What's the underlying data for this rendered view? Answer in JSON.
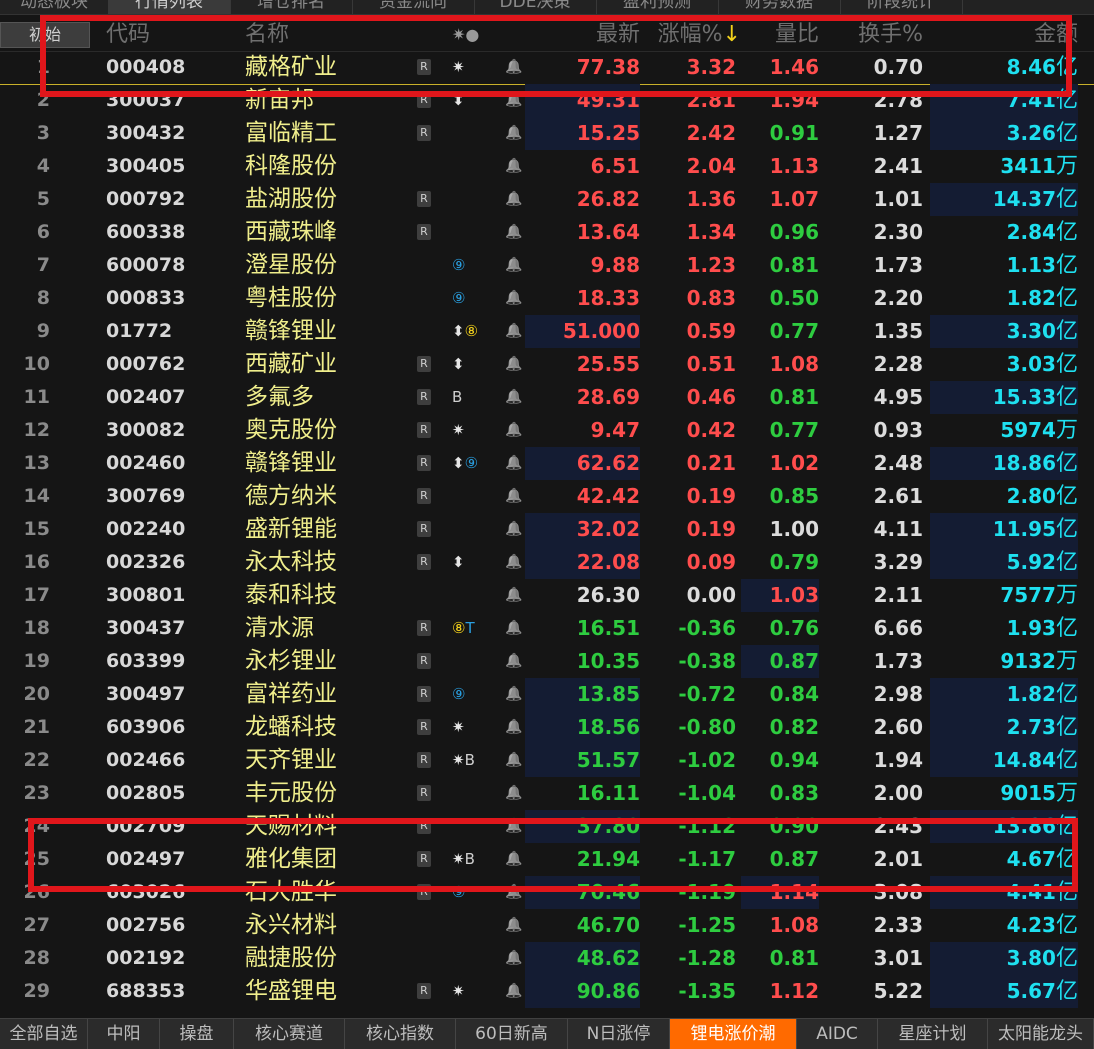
{
  "top_tabs": [
    "动态板块",
    "行情列表",
    "增仓排名",
    "资金流向",
    "DDE决策",
    "盈利预测",
    "财务数据",
    "阶段统计"
  ],
  "top_tab_active": 1,
  "header": {
    "corner_button": "初始",
    "code": "代码",
    "name": "名称",
    "flags": "✷●",
    "price": "最新",
    "change": "涨幅%",
    "sort_arrow": "↓",
    "vol_ratio": "量比",
    "turnover": "换手%",
    "amount": "金额"
  },
  "colors": {
    "up": "#ff4d4d",
    "down": "#2ecc40",
    "flat": "#dcdcdc",
    "amount": "#1fe0f0",
    "name": "#f0ee8c",
    "highlight_box": "#e0161b",
    "active_tab": "#ff6a00"
  },
  "rows": [
    {
      "idx": "1",
      "code": "000408",
      "name": "藏格矿业",
      "r": true,
      "flags": [
        {
          "t": "✷",
          "c": "w"
        }
      ],
      "price": "77.38",
      "change": "3.32",
      "vr": "1.46",
      "turnover": "0.70",
      "amt": "8.46",
      "unit": "亿",
      "pd": "up",
      "cd": "up",
      "vd": "up",
      "price_hl": false,
      "vr_hl": false,
      "amt_hl": false
    },
    {
      "idx": "2",
      "code": "300037",
      "name": "新宙邦",
      "r": true,
      "flags": [
        {
          "t": "⬍",
          "c": "w"
        }
      ],
      "price": "49.31",
      "change": "2.81",
      "vr": "1.94",
      "turnover": "2.78",
      "amt": "7.41",
      "unit": "亿",
      "pd": "up",
      "cd": "up",
      "vd": "up",
      "price_hl": true,
      "vr_hl": false,
      "amt_hl": true
    },
    {
      "idx": "3",
      "code": "300432",
      "name": "富临精工",
      "r": true,
      "flags": [],
      "price": "15.25",
      "change": "2.42",
      "vr": "0.91",
      "turnover": "1.27",
      "amt": "3.26",
      "unit": "亿",
      "pd": "up",
      "cd": "up",
      "vd": "dn",
      "price_hl": true,
      "vr_hl": false,
      "amt_hl": true
    },
    {
      "idx": "4",
      "code": "300405",
      "name": "科隆股份",
      "r": false,
      "flags": [],
      "price": "6.51",
      "change": "2.04",
      "vr": "1.13",
      "turnover": "2.41",
      "amt": "3411",
      "unit": "万",
      "pd": "up",
      "cd": "up",
      "vd": "up",
      "price_hl": false,
      "vr_hl": false,
      "amt_hl": false
    },
    {
      "idx": "5",
      "code": "000792",
      "name": "盐湖股份",
      "r": true,
      "flags": [],
      "price": "26.82",
      "change": "1.36",
      "vr": "1.07",
      "turnover": "1.01",
      "amt": "14.37",
      "unit": "亿",
      "pd": "up",
      "cd": "up",
      "vd": "up",
      "price_hl": false,
      "vr_hl": false,
      "amt_hl": true
    },
    {
      "idx": "6",
      "code": "600338",
      "name": "西藏珠峰",
      "r": true,
      "flags": [],
      "price": "13.64",
      "change": "1.34",
      "vr": "0.96",
      "turnover": "2.30",
      "amt": "2.84",
      "unit": "亿",
      "pd": "up",
      "cd": "up",
      "vd": "dn",
      "price_hl": false,
      "vr_hl": false,
      "amt_hl": false
    },
    {
      "idx": "7",
      "code": "600078",
      "name": "澄星股份",
      "r": false,
      "flags": [
        {
          "t": "⑨",
          "c": "b"
        }
      ],
      "price": "9.88",
      "change": "1.23",
      "vr": "0.81",
      "turnover": "1.73",
      "amt": "1.13",
      "unit": "亿",
      "pd": "up",
      "cd": "up",
      "vd": "dn",
      "price_hl": false,
      "vr_hl": false,
      "amt_hl": false
    },
    {
      "idx": "8",
      "code": "000833",
      "name": "粤桂股份",
      "r": false,
      "flags": [
        {
          "t": "⑨",
          "c": "b"
        }
      ],
      "price": "18.33",
      "change": "0.83",
      "vr": "0.50",
      "turnover": "2.20",
      "amt": "1.82",
      "unit": "亿",
      "pd": "up",
      "cd": "up",
      "vd": "dn",
      "price_hl": false,
      "vr_hl": false,
      "amt_hl": false
    },
    {
      "idx": "9",
      "code": "01772",
      "name": "赣锋锂业",
      "r": false,
      "flags": [
        {
          "t": "⬍",
          "c": "w"
        },
        {
          "t": "⑧",
          "c": "y"
        }
      ],
      "price": "51.000",
      "change": "0.59",
      "vr": "0.77",
      "turnover": "1.35",
      "amt": "3.30",
      "unit": "亿",
      "pd": "up",
      "cd": "up",
      "vd": "dn",
      "price_hl": true,
      "vr_hl": false,
      "amt_hl": true
    },
    {
      "idx": "10",
      "code": "000762",
      "name": "西藏矿业",
      "r": true,
      "flags": [
        {
          "t": "⬍",
          "c": "w"
        }
      ],
      "price": "25.55",
      "change": "0.51",
      "vr": "1.08",
      "turnover": "2.28",
      "amt": "3.03",
      "unit": "亿",
      "pd": "up",
      "cd": "up",
      "vd": "up",
      "price_hl": false,
      "vr_hl": false,
      "amt_hl": false
    },
    {
      "idx": "11",
      "code": "002407",
      "name": "多氟多",
      "r": true,
      "flags": [
        {
          "t": "B",
          "c": "w2"
        }
      ],
      "price": "28.69",
      "change": "0.46",
      "vr": "0.81",
      "turnover": "4.95",
      "amt": "15.33",
      "unit": "亿",
      "pd": "up",
      "cd": "up",
      "vd": "dn",
      "price_hl": false,
      "vr_hl": false,
      "amt_hl": true
    },
    {
      "idx": "12",
      "code": "300082",
      "name": "奥克股份",
      "r": true,
      "flags": [
        {
          "t": "✷",
          "c": "w"
        }
      ],
      "price": "9.47",
      "change": "0.42",
      "vr": "0.77",
      "turnover": "0.93",
      "amt": "5974",
      "unit": "万",
      "pd": "up",
      "cd": "up",
      "vd": "dn",
      "price_hl": false,
      "vr_hl": false,
      "amt_hl": false
    },
    {
      "idx": "13",
      "code": "002460",
      "name": "赣锋锂业",
      "r": true,
      "flags": [
        {
          "t": "⬍",
          "c": "w"
        },
        {
          "t": "⑨",
          "c": "b"
        }
      ],
      "price": "62.62",
      "change": "0.21",
      "vr": "1.02",
      "turnover": "2.48",
      "amt": "18.86",
      "unit": "亿",
      "pd": "up",
      "cd": "up",
      "vd": "up",
      "price_hl": true,
      "vr_hl": false,
      "amt_hl": true
    },
    {
      "idx": "14",
      "code": "300769",
      "name": "德方纳米",
      "r": true,
      "flags": [],
      "price": "42.42",
      "change": "0.19",
      "vr": "0.85",
      "turnover": "2.61",
      "amt": "2.80",
      "unit": "亿",
      "pd": "up",
      "cd": "up",
      "vd": "dn",
      "price_hl": false,
      "vr_hl": false,
      "amt_hl": false
    },
    {
      "idx": "15",
      "code": "002240",
      "name": "盛新锂能",
      "r": true,
      "flags": [],
      "price": "32.02",
      "change": "0.19",
      "vr": "1.00",
      "turnover": "4.11",
      "amt": "11.95",
      "unit": "亿",
      "pd": "up",
      "cd": "up",
      "vd": "fl",
      "price_hl": true,
      "vr_hl": false,
      "amt_hl": true
    },
    {
      "idx": "16",
      "code": "002326",
      "name": "永太科技",
      "r": true,
      "flags": [
        {
          "t": "⬍",
          "c": "w"
        }
      ],
      "price": "22.08",
      "change": "0.09",
      "vr": "0.79",
      "turnover": "3.29",
      "amt": "5.92",
      "unit": "亿",
      "pd": "up",
      "cd": "up",
      "vd": "dn",
      "price_hl": true,
      "vr_hl": false,
      "amt_hl": true
    },
    {
      "idx": "17",
      "code": "300801",
      "name": "泰和科技",
      "r": false,
      "flags": [],
      "price": "26.30",
      "change": "0.00",
      "vr": "1.03",
      "turnover": "2.11",
      "amt": "7577",
      "unit": "万",
      "pd": "fl",
      "cd": "fl",
      "vd": "up",
      "price_hl": false,
      "vr_hl": true,
      "amt_hl": false
    },
    {
      "idx": "18",
      "code": "300437",
      "name": "清水源",
      "r": true,
      "flags": [
        {
          "t": "⑧",
          "c": "y"
        },
        {
          "t": "T",
          "c": "b"
        }
      ],
      "price": "16.51",
      "change": "-0.36",
      "vr": "0.76",
      "turnover": "6.66",
      "amt": "1.93",
      "unit": "亿",
      "pd": "dn",
      "cd": "dn",
      "vd": "dn",
      "price_hl": false,
      "vr_hl": false,
      "amt_hl": false
    },
    {
      "idx": "19",
      "code": "603399",
      "name": "永杉锂业",
      "r": true,
      "flags": [],
      "price": "10.35",
      "change": "-0.38",
      "vr": "0.87",
      "turnover": "1.73",
      "amt": "9132",
      "unit": "万",
      "pd": "dn",
      "cd": "dn",
      "vd": "dn",
      "price_hl": false,
      "vr_hl": true,
      "amt_hl": false
    },
    {
      "idx": "20",
      "code": "300497",
      "name": "富祥药业",
      "r": true,
      "flags": [
        {
          "t": "⑨",
          "c": "b"
        }
      ],
      "price": "13.85",
      "change": "-0.72",
      "vr": "0.84",
      "turnover": "2.98",
      "amt": "1.82",
      "unit": "亿",
      "pd": "dn",
      "cd": "dn",
      "vd": "dn",
      "price_hl": true,
      "vr_hl": false,
      "amt_hl": true
    },
    {
      "idx": "21",
      "code": "603906",
      "name": "龙蟠科技",
      "r": true,
      "flags": [
        {
          "t": "✷",
          "c": "w"
        }
      ],
      "price": "18.56",
      "change": "-0.80",
      "vr": "0.82",
      "turnover": "2.60",
      "amt": "2.73",
      "unit": "亿",
      "pd": "dn",
      "cd": "dn",
      "vd": "dn",
      "price_hl": true,
      "vr_hl": false,
      "amt_hl": true
    },
    {
      "idx": "22",
      "code": "002466",
      "name": "天齐锂业",
      "r": true,
      "flags": [
        {
          "t": "✷",
          "c": "w"
        },
        {
          "t": "B",
          "c": "w2"
        }
      ],
      "price": "51.57",
      "change": "-1.02",
      "vr": "0.94",
      "turnover": "1.94",
      "amt": "14.84",
      "unit": "亿",
      "pd": "dn",
      "cd": "dn",
      "vd": "dn",
      "price_hl": true,
      "vr_hl": false,
      "amt_hl": true
    },
    {
      "idx": "23",
      "code": "002805",
      "name": "丰元股份",
      "r": true,
      "flags": [],
      "price": "16.11",
      "change": "-1.04",
      "vr": "0.83",
      "turnover": "2.00",
      "amt": "9015",
      "unit": "万",
      "pd": "dn",
      "cd": "dn",
      "vd": "dn",
      "price_hl": false,
      "vr_hl": false,
      "amt_hl": false
    },
    {
      "idx": "24",
      "code": "002709",
      "name": "天赐材料",
      "r": true,
      "flags": [],
      "price": "37.80",
      "change": "-1.12",
      "vr": "0.90",
      "turnover": "2.43",
      "amt": "13.86",
      "unit": "亿",
      "pd": "dn",
      "cd": "dn",
      "vd": "dn",
      "price_hl": true,
      "vr_hl": false,
      "amt_hl": true
    },
    {
      "idx": "25",
      "code": "002497",
      "name": "雅化集团",
      "r": true,
      "flags": [
        {
          "t": "✷",
          "c": "w"
        },
        {
          "t": "B",
          "c": "w2"
        }
      ],
      "price": "21.94",
      "change": "-1.17",
      "vr": "0.87",
      "turnover": "2.01",
      "amt": "4.67",
      "unit": "亿",
      "pd": "dn",
      "cd": "dn",
      "vd": "dn",
      "price_hl": false,
      "vr_hl": false,
      "amt_hl": false
    },
    {
      "idx": "26",
      "code": "603026",
      "name": "石大胜华",
      "r": true,
      "flags": [
        {
          "t": "⑨",
          "c": "b"
        }
      ],
      "price": "70.46",
      "change": "-1.19",
      "vr": "1.14",
      "turnover": "3.08",
      "amt": "4.41",
      "unit": "亿",
      "pd": "dn",
      "cd": "dn",
      "vd": "up",
      "price_hl": true,
      "vr_hl": true,
      "amt_hl": true
    },
    {
      "idx": "27",
      "code": "002756",
      "name": "永兴材料",
      "r": false,
      "flags": [],
      "price": "46.70",
      "change": "-1.25",
      "vr": "1.08",
      "turnover": "2.33",
      "amt": "4.23",
      "unit": "亿",
      "pd": "dn",
      "cd": "dn",
      "vd": "up",
      "price_hl": false,
      "vr_hl": false,
      "amt_hl": false
    },
    {
      "idx": "28",
      "code": "002192",
      "name": "融捷股份",
      "r": false,
      "flags": [],
      "price": "48.62",
      "change": "-1.28",
      "vr": "0.81",
      "turnover": "3.01",
      "amt": "3.80",
      "unit": "亿",
      "pd": "dn",
      "cd": "dn",
      "vd": "dn",
      "price_hl": true,
      "vr_hl": false,
      "amt_hl": true
    },
    {
      "idx": "29",
      "code": "688353",
      "name": "华盛锂电",
      "r": true,
      "flags": [
        {
          "t": "✷",
          "c": "w"
        }
      ],
      "price": "90.86",
      "change": "-1.35",
      "vr": "1.12",
      "turnover": "5.22",
      "amt": "5.67",
      "unit": "亿",
      "pd": "dn",
      "cd": "dn",
      "vd": "up",
      "price_hl": true,
      "vr_hl": false,
      "amt_hl": true
    }
  ],
  "r_badge": "R",
  "bell_icon": "bell-icon",
  "bottom_tabs": [
    "全部自选",
    "中阳",
    "操盘",
    "核心赛道",
    "核心指数",
    "60日新高",
    "N日涨停",
    "锂电涨价潮",
    "AIDC",
    "星座计划",
    "太阳能龙头"
  ],
  "bottom_tab_active": 7
}
